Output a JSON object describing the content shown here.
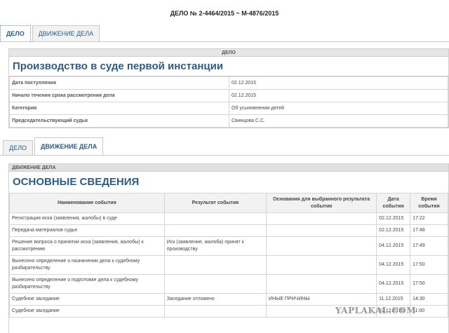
{
  "header": {
    "title": "ДЕЛО № 2-4464/2015 ~ М-4876/2015"
  },
  "top_tabs": [
    {
      "label": "ДЕЛО"
    },
    {
      "label": "ДВИЖЕНИЕ ДЕЛА"
    }
  ],
  "case_panel": {
    "heading": "ДЕЛО",
    "title": "Производство в суде первой инстанции",
    "rows": [
      {
        "key": "Дата поступления",
        "value": "02.12.2015"
      },
      {
        "key": "Начало течения срока рассмотрения дела",
        "value": "02.12.2015"
      },
      {
        "key": "Категория",
        "value": "Об усыновлении детей"
      },
      {
        "key": "Председательствующий судья",
        "value": "Свинцова С.С."
      }
    ]
  },
  "second_tabs": [
    {
      "label": "ДЕЛО"
    },
    {
      "label": "ДВИЖЕНИЕ ДЕЛА"
    }
  ],
  "movement_panel": {
    "heading": "ДВИЖЕНИЕ ДЕЛА",
    "title": "ОСНОВНЫЕ СВЕДЕНИЯ",
    "columns": [
      "Наименование события",
      "Результат события",
      "Основания для выбранного результата события",
      "Дата события",
      "Время события"
    ],
    "events": [
      {
        "name": "Регистрация иска (заявления, жалобы) в суде",
        "result": "",
        "reason": "",
        "date": "02.12.2015",
        "time": "17:22"
      },
      {
        "name": "Передача материалов судье",
        "result": "",
        "reason": "",
        "date": "02.12.2015",
        "time": "17:48"
      },
      {
        "name": "Решение вопроса о принятии иска (заявления, жалобы) к рассмотрению",
        "result": "Иск (заявление, жалоба) принят к производству",
        "reason": "",
        "date": "04.12.2015",
        "time": "17:49"
      },
      {
        "name": "Вынесено определение о назначении дела к судебному разбирательству",
        "result": "",
        "reason": "",
        "date": "04.12.2015",
        "time": "17:50"
      },
      {
        "name": "Вынесено определение о подготовке дела к судебному разбирательству",
        "result": "",
        "reason": "",
        "date": "04.12.2015",
        "time": "17:50"
      },
      {
        "name": "Судебное заседание",
        "result": "Заседание отложено",
        "reason": "ИНЫЕ ПРИЧИНЫ",
        "date": "11.12.2015",
        "time": "14:30"
      },
      {
        "name": "Судебное заседание",
        "result": "",
        "reason": "",
        "date": "22.12.2015",
        "time": "11:00"
      }
    ]
  },
  "watermark": "YAPLAKAL.COM"
}
